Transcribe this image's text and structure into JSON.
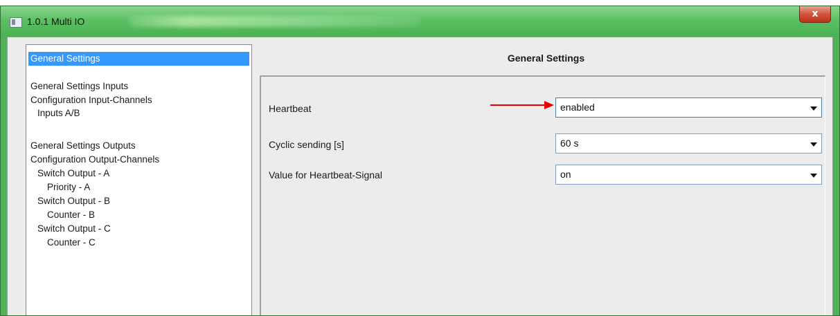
{
  "window": {
    "title": "1.0.1 Multi IO",
    "close_glyph": "x"
  },
  "sidebar": {
    "items": [
      {
        "label": "General Settings",
        "selected": true
      },
      {
        "label": "General Settings Inputs"
      },
      {
        "label": "Configuration Input-Channels"
      },
      {
        "label": "Inputs  A/B"
      },
      {
        "label": "General Settings Outputs"
      },
      {
        "label": "Configuration Output-Channels"
      },
      {
        "label": "Switch Output - A"
      },
      {
        "label": "Priority - A"
      },
      {
        "label": "Switch Output - B"
      },
      {
        "label": "Counter - B"
      },
      {
        "label": "Switch Output - C"
      },
      {
        "label": "Counter - C"
      }
    ]
  },
  "main": {
    "title": "General Settings",
    "params": [
      {
        "label": "Heartbeat",
        "value": "enabled"
      },
      {
        "label": "Cyclic sending [s]",
        "value": "60 s"
      },
      {
        "label": "Value for Heartbeat-Signal",
        "value": "on"
      }
    ]
  },
  "colors": {
    "selection": "#3399ff",
    "title_bar": "#5cc063",
    "annotation_arrow": "#e60000",
    "close_button": "#d2553c"
  },
  "icons": [
    "window-app-icon",
    "close-icon",
    "chevron-down-icon",
    "annotation-arrow"
  ]
}
